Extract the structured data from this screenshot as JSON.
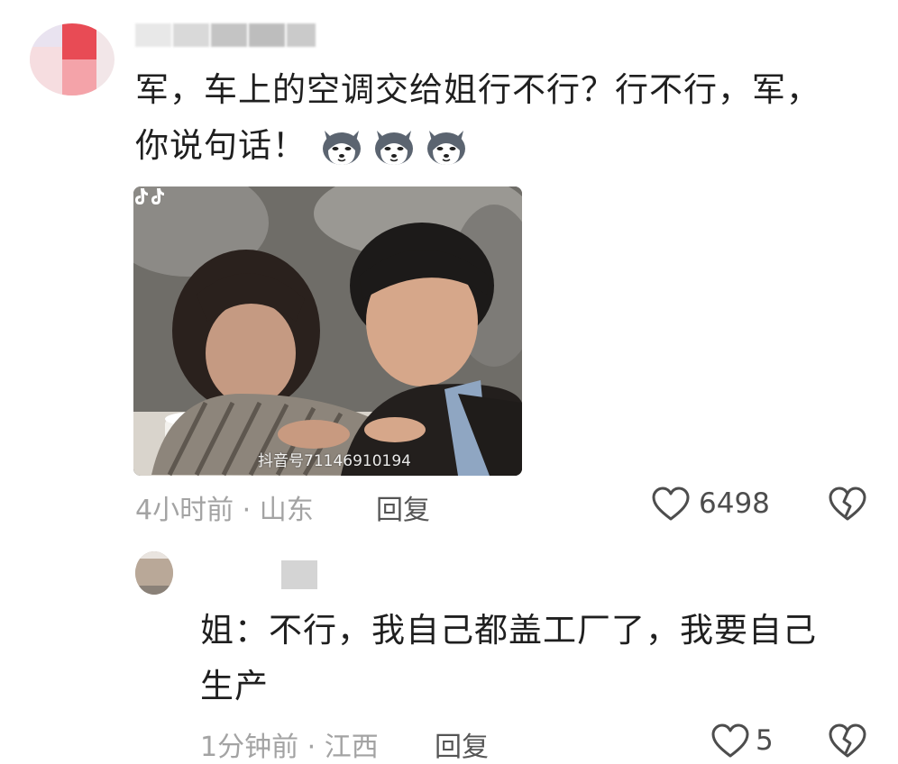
{
  "comments": [
    {
      "text_line1": "军，车上的空调交给姐行不行？行不行，军，",
      "text_line2": "你说句话！",
      "emoji": [
        "husky-emoji",
        "husky-emoji",
        "husky-emoji"
      ],
      "image_watermark": "抖音号71146910194",
      "time_location": "4小时前 · 山东",
      "reply_label": "回复",
      "like_count": "6498"
    },
    {
      "text_line1": "姐：不行，我自己都盖工厂了，我要自己",
      "text_line2": "生产",
      "time_location": "1分钟前 · 江西",
      "reply_label": "回复",
      "like_count": "5"
    }
  ],
  "colors": {
    "text": "#1f1f1f",
    "meta": "#a3a3a3",
    "reply": "#555555",
    "icon": "#4d4d4d"
  }
}
